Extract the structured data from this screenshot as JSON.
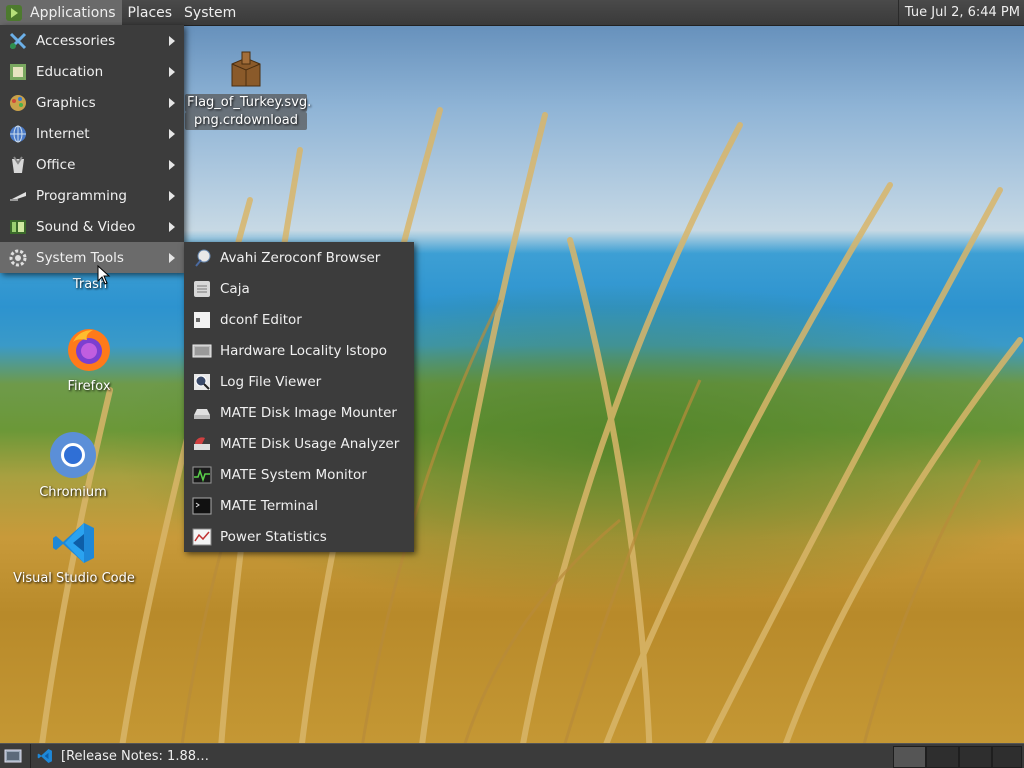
{
  "top_panel": {
    "menus": [
      {
        "label": "Applications"
      },
      {
        "label": "Places"
      },
      {
        "label": "System"
      }
    ],
    "clock": "Tue Jul  2,  6:44 PM"
  },
  "desktop": {
    "icons": [
      {
        "label_1": "Flag_of_Turkey.svg.",
        "label_2": "png.crdownload",
        "icon": "package-icon"
      },
      {
        "label": "Trash",
        "icon": "trash-icon"
      },
      {
        "label": "Firefox",
        "icon": "firefox-icon"
      },
      {
        "label": "Chromium",
        "icon": "chromium-icon"
      },
      {
        "label": "Visual Studio Code",
        "icon": "vscode-icon"
      }
    ]
  },
  "applications_menu": {
    "items": [
      {
        "label": "Accessories",
        "icon": "accessories-icon"
      },
      {
        "label": "Education",
        "icon": "education-icon"
      },
      {
        "label": "Graphics",
        "icon": "graphics-icon"
      },
      {
        "label": "Internet",
        "icon": "internet-icon"
      },
      {
        "label": "Office",
        "icon": "office-icon"
      },
      {
        "label": "Programming",
        "icon": "programming-icon"
      },
      {
        "label": "Sound & Video",
        "icon": "sound-video-icon"
      },
      {
        "label": "System Tools",
        "icon": "system-tools-icon"
      }
    ],
    "active_item": "System Tools"
  },
  "system_tools_menu": {
    "items": [
      {
        "label": "Avahi Zeroconf Browser",
        "icon": "avahi-icon"
      },
      {
        "label": "Caja",
        "icon": "caja-icon"
      },
      {
        "label": "dconf Editor",
        "icon": "dconf-icon"
      },
      {
        "label": "Hardware Locality lstopo",
        "icon": "hardware-icon"
      },
      {
        "label": "Log File Viewer",
        "icon": "log-viewer-icon"
      },
      {
        "label": "MATE Disk Image Mounter",
        "icon": "disk-mounter-icon"
      },
      {
        "label": "MATE Disk Usage Analyzer",
        "icon": "disk-usage-icon"
      },
      {
        "label": "MATE System Monitor",
        "icon": "system-monitor-icon"
      },
      {
        "label": "MATE Terminal",
        "icon": "terminal-icon"
      },
      {
        "label": "Power Statistics",
        "icon": "power-stats-icon"
      }
    ]
  },
  "bottom_panel": {
    "task_label": "[Release Notes: 1.88…"
  },
  "colors": {
    "panel": "#3b3b3b",
    "menu_bg": "#3c3c3c",
    "menu_active": "#6b6b6b"
  }
}
